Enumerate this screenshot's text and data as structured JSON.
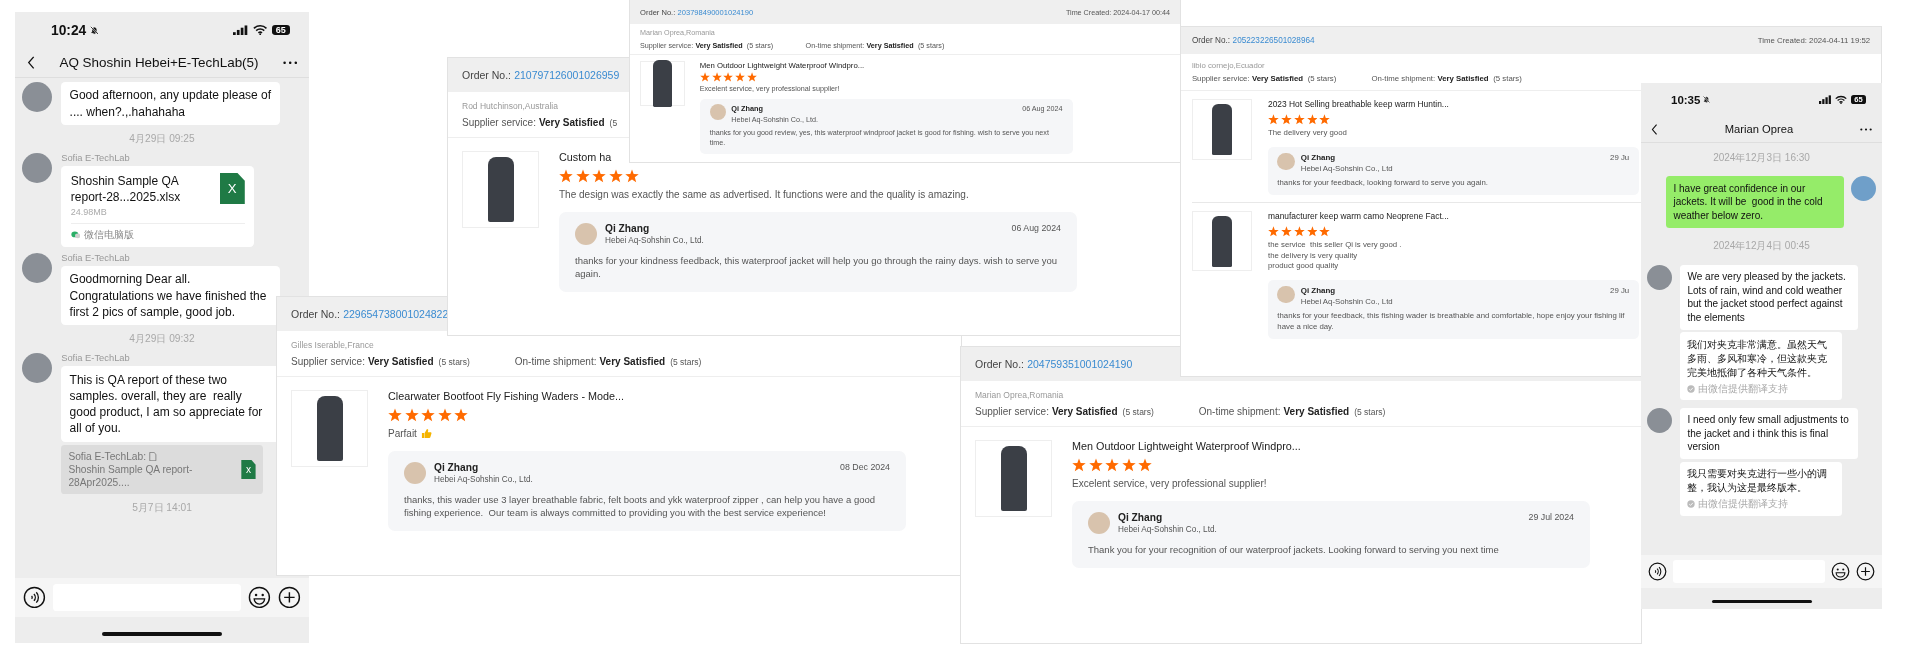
{
  "chat_left": {
    "time": "10:24",
    "battery": "65",
    "title": "AQ Shoshin Hebei+E-TechLab(5)",
    "messages": [
      {
        "kind": "text",
        "outgoing": false,
        "text": "Good afternoon, any update please of .... when?.,.hahahaha"
      },
      {
        "kind": "time",
        "text": "4月29日 09:25"
      },
      {
        "kind": "file",
        "outgoing": false,
        "sender": "Sofia E-TechLab",
        "file_name": "Shoshin Sample QA report-28...2025.xlsx",
        "size": "24.98MB",
        "badge": "X",
        "source": "微信电脑版"
      },
      {
        "kind": "text",
        "outgoing": false,
        "sender": "Sofia E-TechLab",
        "text": "Goodmorning Dear all. Congratulations we have finished the first 2 pics of sample, good job."
      },
      {
        "kind": "time",
        "text": "4月29日 09:32"
      },
      {
        "kind": "text",
        "outgoing": false,
        "sender": "Sofia E-TechLab",
        "text": "This is QA report of these two samples. overall, they are  really good product, I am so appreciate for all of you.",
        "quote": {
          "sender": "Sofia E-TechLab:",
          "file": "Shoshin Sample QA report-28Apr2025....",
          "badge": "x"
        }
      },
      {
        "kind": "time",
        "text": "5月7日 14:01"
      }
    ]
  },
  "reviews": [
    {
      "order_label": "Order No.:",
      "order_no": "210797126001026959",
      "buyer": "Rod Hutchinson,Australia",
      "ratings": [
        {
          "label": "Supplier service:",
          "value": "Very Satisfied",
          "note": "(5"
        }
      ],
      "products": [
        {
          "title": "Custom ha",
          "stars": 5,
          "comment": "The design was exactly the same as advertised. It functions were and the quality is amazing.",
          "reply": {
            "name": "Qi Zhang",
            "company": "Hebei Aq-Sohshin Co., Ltd.",
            "date": "06 Aug 2024",
            "text": "thanks for your kindness feedback, this waterproof jacket will help you go through the rainy days. wish to serve you again."
          }
        }
      ]
    },
    {
      "order_label": "Order No.:",
      "order_no": "203798490001024190",
      "time_created": "Time Created: 2024-04-17 00:44",
      "buyer": "Marian Oprea,Romania",
      "ratings": [
        {
          "label": "Supplier service:",
          "value": "Very Satisfied",
          "note": "(5 stars)"
        },
        {
          "label": "On-time shipment:",
          "value": "Very Satisfied",
          "note": "(5 stars)"
        }
      ],
      "products": [
        {
          "title": "Men Outdoor Lightweight Waterproof Windpro...",
          "stars": 5,
          "comment": "Excelent service, very professional supplier!",
          "reply": {
            "name": "Qi Zhang",
            "company": "Hebei Aq-Sohshin Co., Ltd.",
            "date": "06 Aug 2024",
            "text": "thanks for you good review, yes, this waterproof windproof jacket is good for fishing. wish to serve you next time."
          }
        }
      ]
    },
    {
      "order_label": "Order No.:",
      "order_no": "229654738001024822",
      "buyer": "Gilles Iserable,France",
      "ratings": [
        {
          "label": "Supplier service:",
          "value": "Very Satisfied",
          "note": "(5 stars)"
        },
        {
          "label": "On-time shipment:",
          "value": "Very Satisfied",
          "note": "(5 stars)"
        }
      ],
      "products": [
        {
          "title": "Clearwater Bootfoot Fly Fishing Waders - Mode...",
          "stars": 5,
          "comment": "Parfait",
          "thumbs_up": true,
          "reply": {
            "name": "Qi Zhang",
            "company": "Hebei Aq-Sohshin Co., Ltd.",
            "date": "08 Dec 2024",
            "text": "thanks, this wader use 3 layer breathable fabric, felt boots and ykk waterproof zipper , can help you have a good fishing experience.  Our team is always committed to providing you with the best service experience!"
          }
        }
      ]
    },
    {
      "order_label": "Order No.:",
      "order_no": "205223226501028964",
      "time_created": "Time Created: 2024-04-11 19:52",
      "buyer": "libio cornejo,Ecuador",
      "ratings": [
        {
          "label": "Supplier service:",
          "value": "Very Satisfied",
          "note": "(5 stars)"
        },
        {
          "label": "On-time shipment:",
          "value": "Very Satisfied",
          "note": "(5 stars)"
        }
      ],
      "products": [
        {
          "title": "2023 Hot Selling breathable keep warm Huntin...",
          "stars": 5,
          "comment": "The delivery very good",
          "reply": {
            "name": "Qi Zhang",
            "company": "Hebei Aq-Sohshin Co., Ltd",
            "date": "29 Ju",
            "text": "thanks for your feedback, looking forward to serve you again."
          }
        },
        {
          "title": "manufacturer keep warm camo Neoprene Fact...",
          "stars": 5,
          "comment": "the service  this seller Qi is very good .\nthe delivery is very quality\nproduct good quality",
          "reply": {
            "name": "Qi Zhang",
            "company": "Hebei Aq-Sohshin Co., Ltd",
            "date": "29 Ju",
            "text": "thanks for your feedback, this fishing wader is breathable and comfortable, hope enjoy your fishing lif\nhave a nice day."
          }
        }
      ]
    },
    {
      "order_label": "Order No.:",
      "order_no": "204759351001024190",
      "buyer": "Marian Oprea,Romania",
      "ratings": [
        {
          "label": "Supplier service:",
          "value": "Very Satisfied",
          "note": "(5 stars)"
        },
        {
          "label": "On-time shipment:",
          "value": "Very Satisfied",
          "note": "(5 stars)"
        }
      ],
      "products": [
        {
          "title": "Men Outdoor Lightweight Waterproof Windpro...",
          "stars": 5,
          "comment": "Excelent service, very professional supplier!",
          "reply": {
            "name": "Qi Zhang",
            "company": "Hebei Aq-Sohshin Co., Ltd.",
            "date": "29 Jul 2024",
            "text": "Thank you for your recognition of our waterproof jackets. Looking forward to serving you next time"
          }
        }
      ]
    }
  ],
  "chat_right": {
    "time": "10:35",
    "battery": "65",
    "title": "Marian Oprea",
    "messages": [
      {
        "kind": "time",
        "text": "2024年12月3日 16:30"
      },
      {
        "kind": "text",
        "outgoing": true,
        "text": "I have great confidence in our jackets. It will be  good in the cold weather below zero."
      },
      {
        "kind": "time",
        "text": "2024年12月4日 00:45"
      },
      {
        "kind": "text",
        "outgoing": false,
        "text": "We are very pleased by the jackets. Lots of rain, wind and cold weather but the jacket stood perfect against the elements",
        "translation": "我们对夹克非常满意。虽然天气多雨、多风和寒冷，但这款夹克完美地抵御了各种天气条件。",
        "translation_note": "由微信提供翻译支持"
      },
      {
        "kind": "text",
        "outgoing": false,
        "text": "I need only few small adjustments to the jacket and i think this is final version",
        "translation": "我只需要对夹克进行一些小的调整，我认为这是最终版本。",
        "translation_note": "由微信提供翻译支持"
      }
    ]
  }
}
